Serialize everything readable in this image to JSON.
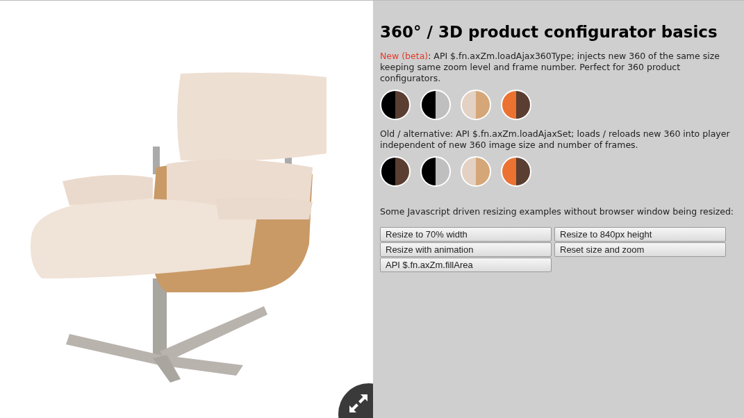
{
  "title": "360° / 3D product configurator basics",
  "new_section": {
    "tag": "New (beta)",
    "text": ": API $.fn.axZm.loadAjax360Type; injects new 360 of the same size keeping same zoom level and frame number. Perfect for 360 product configurators.",
    "swatches": [
      {
        "halves": [
          {
            "color": "#000000"
          },
          {
            "color": "#5a3e31"
          }
        ]
      },
      {
        "halves": [
          {
            "color": "#000000"
          },
          {
            "color": "#bfbfbf"
          }
        ]
      },
      {
        "halves": [
          {
            "color": "#e3d1c4"
          },
          {
            "color": "#d5a677"
          }
        ]
      },
      {
        "halves": [
          {
            "color": "#ec7232"
          },
          {
            "color": "#5a3e31"
          }
        ]
      }
    ]
  },
  "old_section": {
    "text": "Old / alternative: API $.fn.axZm.loadAjaxSet; loads / reloads new 360 into player independent of new 360 image size and number of frames.",
    "swatches": [
      {
        "halves": [
          {
            "color": "#000000"
          },
          {
            "color": "#5a3e31"
          }
        ]
      },
      {
        "halves": [
          {
            "color": "#000000"
          },
          {
            "color": "#bfbfbf"
          }
        ]
      },
      {
        "halves": [
          {
            "color": "#e3d1c4"
          },
          {
            "color": "#d5a677"
          }
        ]
      },
      {
        "halves": [
          {
            "color": "#ec7232"
          },
          {
            "color": "#5a3e31"
          }
        ]
      }
    ]
  },
  "resize_intro": "Some Javascript driven resizing examples without browser window being resized:",
  "buttons": [
    "Resize to 70% width",
    "Resize to 840px height",
    "Resize with animation",
    "Reset size and zoom",
    "API $.fn.axZm.fillArea"
  ]
}
